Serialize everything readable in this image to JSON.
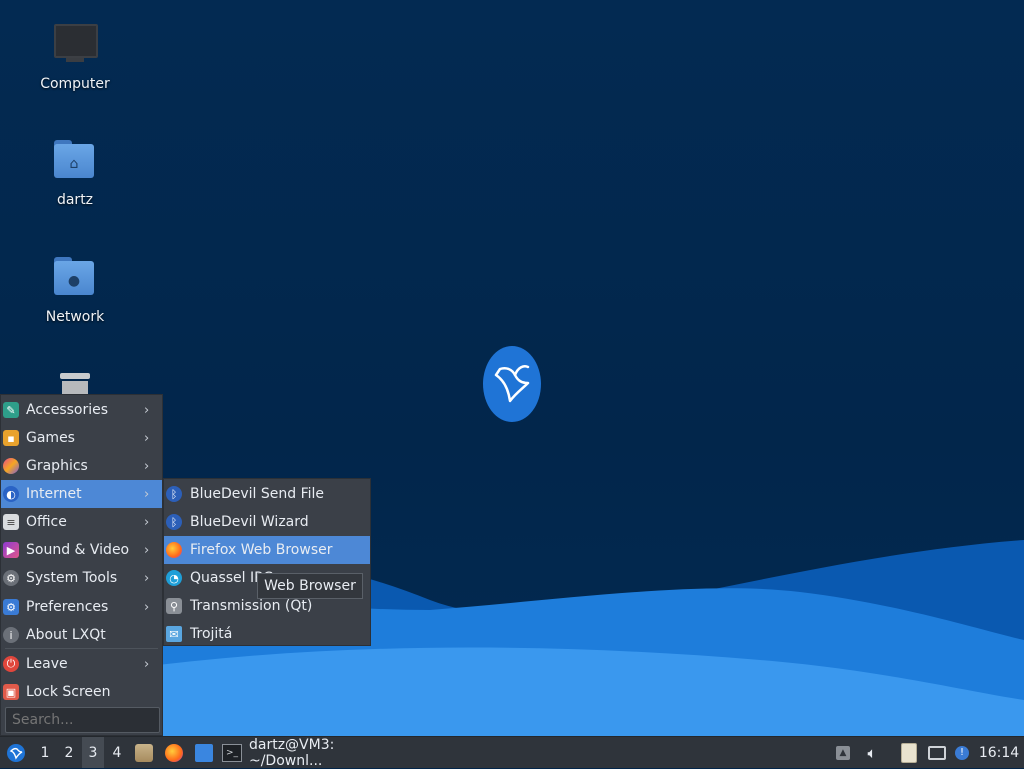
{
  "desktop": {
    "icons": [
      {
        "label": "Computer",
        "icon": "computer-icon"
      },
      {
        "label": "dartz",
        "icon": "home-folder-icon"
      },
      {
        "label": "Network",
        "icon": "network-folder-icon"
      },
      {
        "label": "",
        "icon": "trash-icon"
      }
    ],
    "logo": "lubuntu-bird-logo"
  },
  "menu": {
    "items": [
      {
        "label": "Accessories",
        "icon": "accessories-icon",
        "submenu": true
      },
      {
        "label": "Games",
        "icon": "games-icon",
        "submenu": true
      },
      {
        "label": "Graphics",
        "icon": "graphics-icon",
        "submenu": true
      },
      {
        "label": "Internet",
        "icon": "internet-icon",
        "submenu": true,
        "active": true
      },
      {
        "label": "Office",
        "icon": "office-icon",
        "submenu": true
      },
      {
        "label": "Sound & Video",
        "icon": "sound-video-icon",
        "submenu": true
      },
      {
        "label": "System Tools",
        "icon": "system-tools-icon",
        "submenu": true
      },
      {
        "label": "Preferences",
        "icon": "preferences-icon",
        "submenu": true
      },
      {
        "label": "About LXQt",
        "icon": "info-icon",
        "submenu": false
      },
      {
        "label": "Leave",
        "icon": "power-icon",
        "submenu": true
      },
      {
        "label": "Lock Screen",
        "icon": "lock-icon",
        "submenu": false
      }
    ],
    "search_placeholder": "Search..."
  },
  "submenu": {
    "items": [
      {
        "label": "BlueDevil Send File",
        "icon": "bluetooth-icon"
      },
      {
        "label": "BlueDevil Wizard",
        "icon": "bluetooth-icon"
      },
      {
        "label": "Firefox Web Browser",
        "icon": "firefox-icon",
        "active": true
      },
      {
        "label": "Quassel IRC",
        "icon": "quassel-icon"
      },
      {
        "label": "Transmission (Qt)",
        "icon": "transmission-icon"
      },
      {
        "label": "Trojitá",
        "icon": "trojita-mail-icon"
      }
    ]
  },
  "tooltip": "Web Browser",
  "taskbar": {
    "workspaces": [
      "1",
      "2",
      "3",
      "4"
    ],
    "current_workspace": "3",
    "quicklaunch": [
      "file-manager-icon",
      "firefox-icon",
      "show-desktop-icon"
    ],
    "task_label": "dartz@VM3: ~/Downl...",
    "tray": [
      "tray-arrow-icon",
      "volume-icon",
      "clipboard-icon",
      "network-icon",
      "update-notifier-icon"
    ],
    "clock": "16:14"
  },
  "colors": {
    "accent": "#4d88d6",
    "desktop": "#02264b",
    "panel": "#2f343b",
    "menu": "#3b4048"
  }
}
